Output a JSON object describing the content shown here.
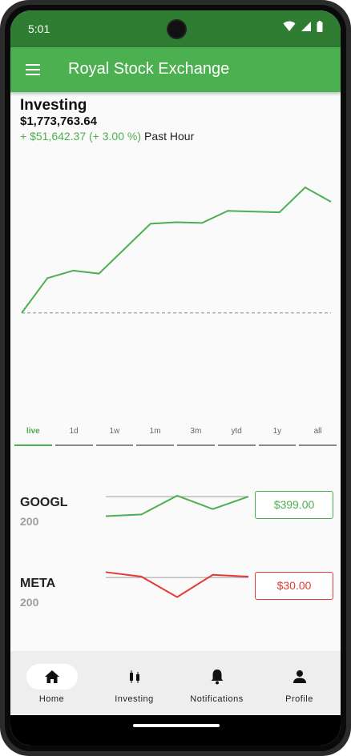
{
  "status_bar": {
    "time": "5:01"
  },
  "app_bar": {
    "title": "Royal Stock Exchange",
    "menu_icon": "hamburger-menu-icon"
  },
  "portfolio": {
    "title": "Investing",
    "value": "$1,773,763.64",
    "change": "+ $51,642.37 (+ 3.00 %)",
    "period": "Past Hour"
  },
  "colors": {
    "up": "#4caf50",
    "down": "#e53935",
    "baseline": "#9e9e9e",
    "app_bar": "#4caf50",
    "status_bar": "#2e7d32"
  },
  "chart_data": {
    "type": "line",
    "title": "",
    "series": [
      {
        "values": [
          0,
          46,
          56,
          52,
          85,
          118,
          120,
          119,
          135,
          134,
          133,
          166,
          147
        ]
      }
    ],
    "baseline": 0,
    "ylim": [
      -140,
      220
    ],
    "grid": false
  },
  "range_tabs": [
    {
      "label": "live",
      "active": true
    },
    {
      "label": "1d",
      "active": false
    },
    {
      "label": "1w",
      "active": false
    },
    {
      "label": "1m",
      "active": false
    },
    {
      "label": "3m",
      "active": false
    },
    {
      "label": "ytd",
      "active": false
    },
    {
      "label": "1y",
      "active": false
    },
    {
      "label": "all",
      "active": false
    }
  ],
  "stocks": [
    {
      "symbol": "GOOGL",
      "shares": "200",
      "price": "$399.00",
      "trend": "up",
      "spark": [
        -22,
        -20,
        1,
        -14,
        0
      ],
      "baseline": 0
    },
    {
      "symbol": "META",
      "shares": "200",
      "price": "$30.00",
      "trend": "down",
      "spark": [
        6,
        1,
        -22,
        3,
        1
      ],
      "baseline": 0
    }
  ],
  "bottom_nav": [
    {
      "label": "Home",
      "icon": "home-icon",
      "active": true
    },
    {
      "label": "Investing",
      "icon": "candlestick-icon",
      "active": false
    },
    {
      "label": "Notifications",
      "icon": "bell-icon",
      "active": false
    },
    {
      "label": "Profile",
      "icon": "person-icon",
      "active": false
    }
  ]
}
